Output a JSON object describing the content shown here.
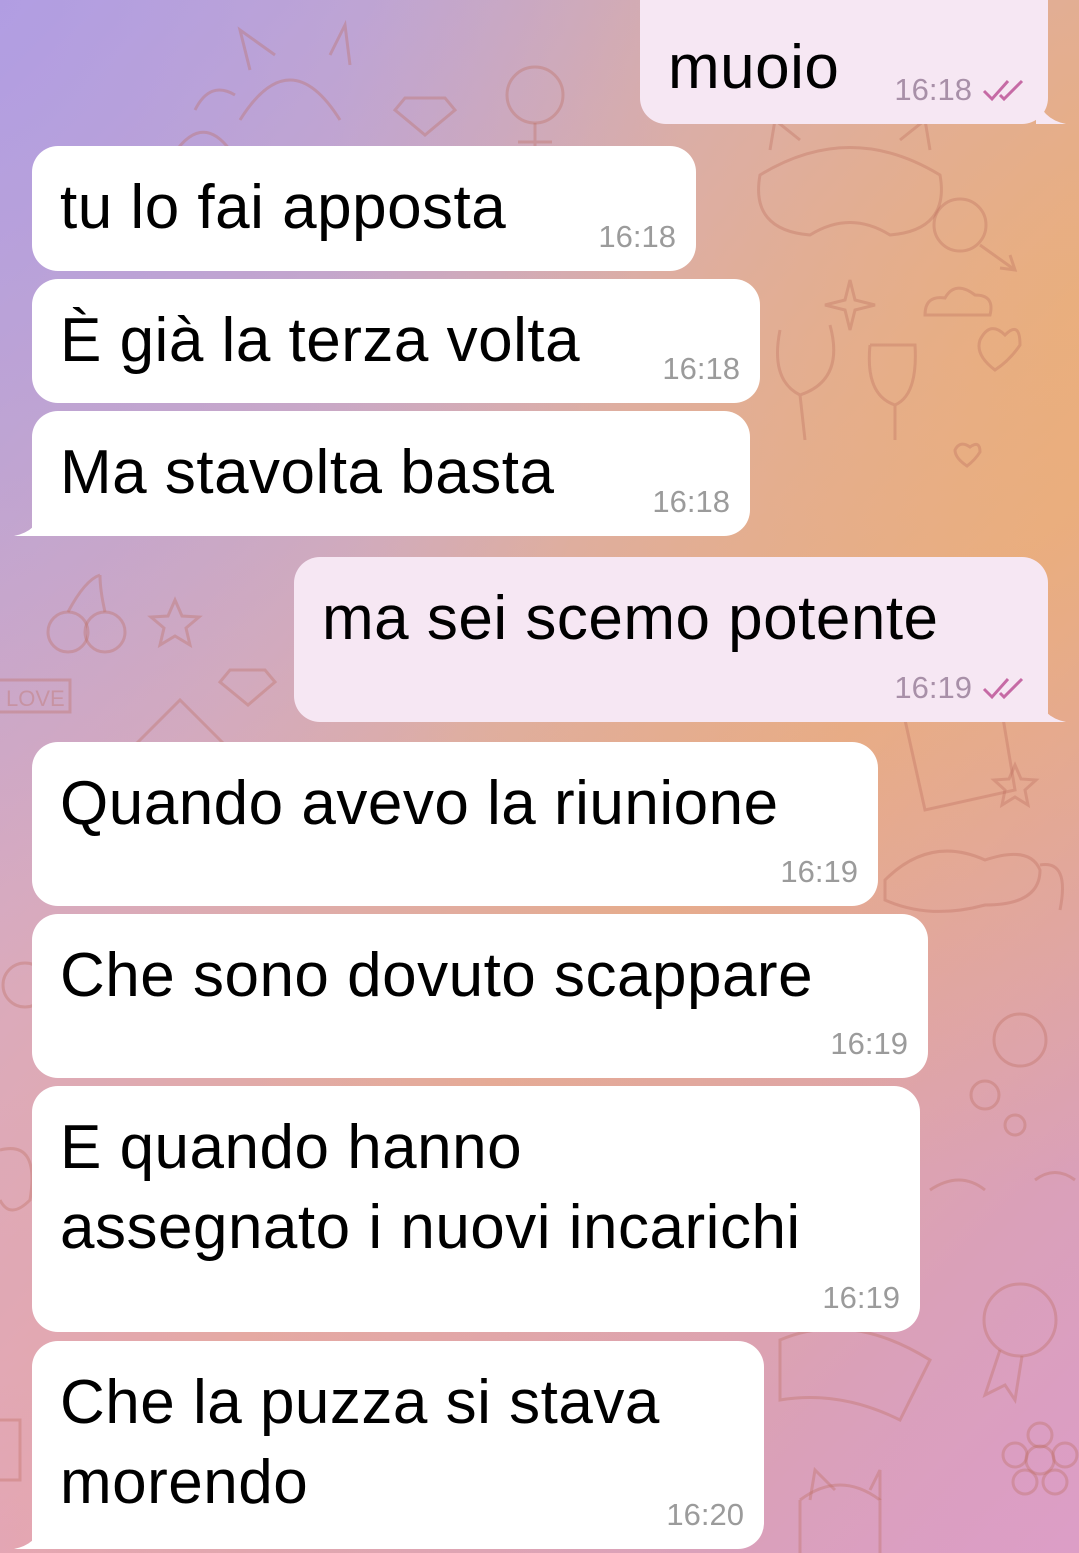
{
  "colors": {
    "incoming_bubble": "#ffffff",
    "outgoing_bubble": "#f6e7f3",
    "time_text": "#9b9b9b",
    "read_checks": "#c66aa5"
  },
  "messages": [
    {
      "direction": "outgoing",
      "text": "muoio",
      "time": "16:18",
      "status": "read"
    },
    {
      "direction": "incoming",
      "text": "tu lo fai apposta",
      "time": "16:18"
    },
    {
      "direction": "incoming",
      "text": "È già la terza volta",
      "time": "16:18"
    },
    {
      "direction": "incoming",
      "text": "Ma stavolta basta",
      "time": "16:18"
    },
    {
      "direction": "outgoing",
      "text": "ma sei scemo potente",
      "time": "16:19",
      "status": "read"
    },
    {
      "direction": "incoming",
      "text": "Quando avevo la riunione",
      "time": "16:19"
    },
    {
      "direction": "incoming",
      "text": "Che sono dovuto scappare",
      "time": "16:19"
    },
    {
      "direction": "incoming",
      "text": "E quando hanno assegnato i nuovi incarichi",
      "line1": "E quando hanno",
      "line2": "assegnato i nuovi incarichi",
      "time": "16:19"
    },
    {
      "direction": "incoming",
      "text": "Che la puzza si stava morendo",
      "line1": "Che la puzza si stava",
      "line2": "morendo",
      "time": "16:20"
    }
  ],
  "background_pattern_text": "LOVE",
  "icons": {
    "read_receipt": "double-check-icon"
  }
}
